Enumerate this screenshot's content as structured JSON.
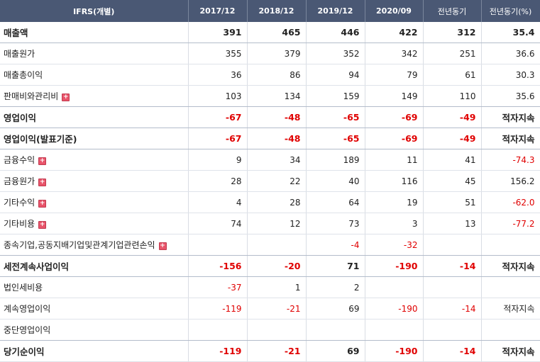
{
  "header": {
    "label_col": "IFRS(개별)",
    "columns": [
      "2017/12",
      "2018/12",
      "2019/12",
      "2020/09",
      "전년동기",
      "전년동기(%)"
    ]
  },
  "rows": [
    {
      "label": "매출액",
      "bold": true,
      "expand": false,
      "sep": true,
      "values": [
        "391",
        "465",
        "446",
        "422",
        "312",
        "35.4"
      ],
      "neg": [
        false,
        false,
        false,
        false,
        false,
        false
      ]
    },
    {
      "label": "매출원가",
      "bold": false,
      "expand": false,
      "sep": false,
      "values": [
        "355",
        "379",
        "352",
        "342",
        "251",
        "36.6"
      ],
      "neg": [
        false,
        false,
        false,
        false,
        false,
        false
      ]
    },
    {
      "label": "매출총이익",
      "bold": false,
      "expand": false,
      "sep": false,
      "values": [
        "36",
        "86",
        "94",
        "79",
        "61",
        "30.3"
      ],
      "neg": [
        false,
        false,
        false,
        false,
        false,
        false
      ]
    },
    {
      "label": "판매비와관리비",
      "bold": false,
      "expand": true,
      "sep": true,
      "values": [
        "103",
        "134",
        "159",
        "149",
        "110",
        "35.6"
      ],
      "neg": [
        false,
        false,
        false,
        false,
        false,
        false
      ]
    },
    {
      "label": "영업이익",
      "bold": true,
      "expand": false,
      "sep": true,
      "values": [
        "-67",
        "-48",
        "-65",
        "-69",
        "-49",
        "적자지속"
      ],
      "neg": [
        true,
        true,
        true,
        true,
        true,
        false
      ]
    },
    {
      "label": "영업이익(발표기준)",
      "bold": true,
      "expand": false,
      "sep": true,
      "values": [
        "-67",
        "-48",
        "-65",
        "-69",
        "-49",
        "적자지속"
      ],
      "neg": [
        true,
        true,
        true,
        true,
        true,
        false
      ]
    },
    {
      "label": "금융수익",
      "bold": false,
      "expand": true,
      "sep": false,
      "values": [
        "9",
        "34",
        "189",
        "11",
        "41",
        "-74.3"
      ],
      "neg": [
        false,
        false,
        false,
        false,
        false,
        true
      ]
    },
    {
      "label": "금융원가",
      "bold": false,
      "expand": true,
      "sep": false,
      "values": [
        "28",
        "22",
        "40",
        "116",
        "45",
        "156.2"
      ],
      "neg": [
        false,
        false,
        false,
        false,
        false,
        false
      ]
    },
    {
      "label": "기타수익",
      "bold": false,
      "expand": true,
      "sep": false,
      "values": [
        "4",
        "28",
        "64",
        "19",
        "51",
        "-62.0"
      ],
      "neg": [
        false,
        false,
        false,
        false,
        false,
        true
      ]
    },
    {
      "label": "기타비용",
      "bold": false,
      "expand": true,
      "sep": false,
      "values": [
        "74",
        "12",
        "73",
        "3",
        "13",
        "-77.2"
      ],
      "neg": [
        false,
        false,
        false,
        false,
        false,
        true
      ]
    },
    {
      "label": "종속기업,공동지배기업및관계기업관련손익",
      "bold": false,
      "expand": true,
      "sep": true,
      "values": [
        "",
        "",
        "-4",
        "-32",
        "",
        ""
      ],
      "neg": [
        false,
        false,
        true,
        true,
        false,
        false
      ]
    },
    {
      "label": "세전계속사업이익",
      "bold": true,
      "expand": false,
      "sep": true,
      "values": [
        "-156",
        "-20",
        "71",
        "-190",
        "-14",
        "적자지속"
      ],
      "neg": [
        true,
        true,
        false,
        true,
        true,
        false
      ]
    },
    {
      "label": "법인세비용",
      "bold": false,
      "expand": false,
      "sep": false,
      "values": [
        "-37",
        "1",
        "2",
        "",
        "",
        ""
      ],
      "neg": [
        true,
        false,
        false,
        false,
        false,
        false
      ]
    },
    {
      "label": "계속영업이익",
      "bold": false,
      "expand": false,
      "sep": false,
      "values": [
        "-119",
        "-21",
        "69",
        "-190",
        "-14",
        "적자지속"
      ],
      "neg": [
        true,
        true,
        false,
        true,
        true,
        false
      ]
    },
    {
      "label": "중단영업이익",
      "bold": false,
      "expand": false,
      "sep": true,
      "values": [
        "",
        "",
        "",
        "",
        "",
        ""
      ],
      "neg": [
        false,
        false,
        false,
        false,
        false,
        false
      ]
    },
    {
      "label": "당기순이익",
      "bold": true,
      "expand": false,
      "sep": false,
      "values": [
        "-119",
        "-21",
        "69",
        "-190",
        "-14",
        "적자지속"
      ],
      "neg": [
        true,
        true,
        false,
        true,
        true,
        false
      ]
    }
  ],
  "expand_glyph": "+",
  "colors": {
    "header_bg": "#4a5874",
    "negative": "#e00000",
    "expand_icon": "#e8546a"
  }
}
